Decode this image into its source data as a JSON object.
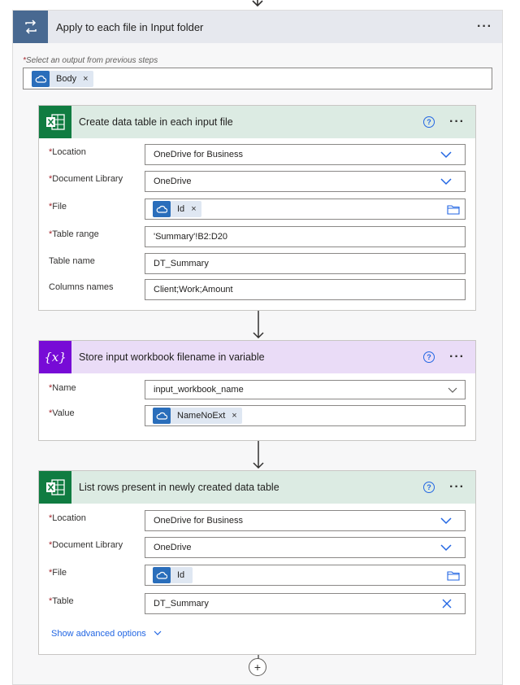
{
  "loop": {
    "title": "Apply to each file in Input folder",
    "select_label": "Select an output from previous steps",
    "select_token": "Body"
  },
  "card1": {
    "title": "Create data table in each input file",
    "fields": {
      "location": {
        "label": "Location",
        "value": "OneDrive for Business"
      },
      "library": {
        "label": "Document Library",
        "value": "OneDrive"
      },
      "file": {
        "label": "File",
        "token": "Id"
      },
      "range": {
        "label": "Table range",
        "value": "'Summary'!B2:D20"
      },
      "tname": {
        "label": "Table name",
        "value": "DT_Summary"
      },
      "cols": {
        "label": "Columns names",
        "value": "Client;Work;Amount"
      }
    }
  },
  "card2": {
    "title": "Store input workbook filename in variable",
    "icon_text": "{x}",
    "fields": {
      "name": {
        "label": "Name",
        "value": "input_workbook_name"
      },
      "value": {
        "label": "Value",
        "token": "NameNoExt"
      }
    }
  },
  "card3": {
    "title": "List rows present in newly created data table",
    "fields": {
      "location": {
        "label": "Location",
        "value": "OneDrive for Business"
      },
      "library": {
        "label": "Document Library",
        "value": "OneDrive"
      },
      "file": {
        "label": "File",
        "token": "Id"
      },
      "table": {
        "label": "Table",
        "value": "DT_Summary"
      }
    },
    "advanced": "Show advanced options"
  },
  "symbols": {
    "required": "*",
    "token_remove": "×",
    "help": "?",
    "more": "···",
    "add": "+"
  },
  "colors": {
    "loop_icon": "#486991",
    "excel": "#107c41",
    "excel_header": "#dcebe3",
    "variable": "#770bd6",
    "variable_header": "#eadcf7",
    "link": "#2266e3",
    "token_icon": "#2a6ebb"
  }
}
